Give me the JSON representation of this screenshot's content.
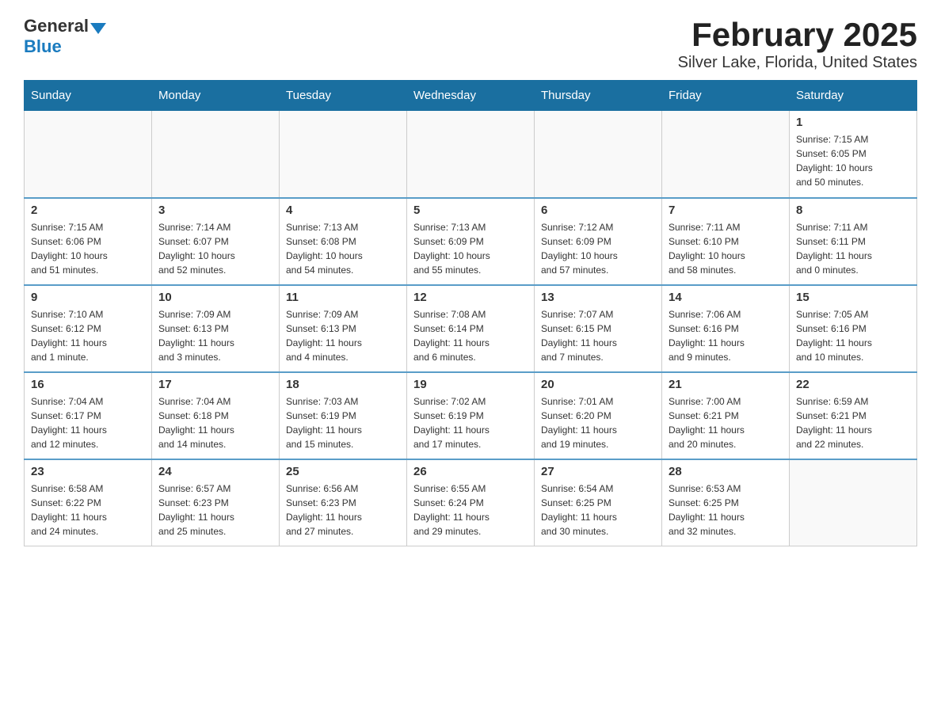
{
  "header": {
    "logo_general": "General",
    "logo_blue": "Blue",
    "title": "February 2025",
    "subtitle": "Silver Lake, Florida, United States"
  },
  "weekdays": [
    "Sunday",
    "Monday",
    "Tuesday",
    "Wednesday",
    "Thursday",
    "Friday",
    "Saturday"
  ],
  "weeks": [
    [
      {
        "day": "",
        "info": ""
      },
      {
        "day": "",
        "info": ""
      },
      {
        "day": "",
        "info": ""
      },
      {
        "day": "",
        "info": ""
      },
      {
        "day": "",
        "info": ""
      },
      {
        "day": "",
        "info": ""
      },
      {
        "day": "1",
        "info": "Sunrise: 7:15 AM\nSunset: 6:05 PM\nDaylight: 10 hours\nand 50 minutes."
      }
    ],
    [
      {
        "day": "2",
        "info": "Sunrise: 7:15 AM\nSunset: 6:06 PM\nDaylight: 10 hours\nand 51 minutes."
      },
      {
        "day": "3",
        "info": "Sunrise: 7:14 AM\nSunset: 6:07 PM\nDaylight: 10 hours\nand 52 minutes."
      },
      {
        "day": "4",
        "info": "Sunrise: 7:13 AM\nSunset: 6:08 PM\nDaylight: 10 hours\nand 54 minutes."
      },
      {
        "day": "5",
        "info": "Sunrise: 7:13 AM\nSunset: 6:09 PM\nDaylight: 10 hours\nand 55 minutes."
      },
      {
        "day": "6",
        "info": "Sunrise: 7:12 AM\nSunset: 6:09 PM\nDaylight: 10 hours\nand 57 minutes."
      },
      {
        "day": "7",
        "info": "Sunrise: 7:11 AM\nSunset: 6:10 PM\nDaylight: 10 hours\nand 58 minutes."
      },
      {
        "day": "8",
        "info": "Sunrise: 7:11 AM\nSunset: 6:11 PM\nDaylight: 11 hours\nand 0 minutes."
      }
    ],
    [
      {
        "day": "9",
        "info": "Sunrise: 7:10 AM\nSunset: 6:12 PM\nDaylight: 11 hours\nand 1 minute."
      },
      {
        "day": "10",
        "info": "Sunrise: 7:09 AM\nSunset: 6:13 PM\nDaylight: 11 hours\nand 3 minutes."
      },
      {
        "day": "11",
        "info": "Sunrise: 7:09 AM\nSunset: 6:13 PM\nDaylight: 11 hours\nand 4 minutes."
      },
      {
        "day": "12",
        "info": "Sunrise: 7:08 AM\nSunset: 6:14 PM\nDaylight: 11 hours\nand 6 minutes."
      },
      {
        "day": "13",
        "info": "Sunrise: 7:07 AM\nSunset: 6:15 PM\nDaylight: 11 hours\nand 7 minutes."
      },
      {
        "day": "14",
        "info": "Sunrise: 7:06 AM\nSunset: 6:16 PM\nDaylight: 11 hours\nand 9 minutes."
      },
      {
        "day": "15",
        "info": "Sunrise: 7:05 AM\nSunset: 6:16 PM\nDaylight: 11 hours\nand 10 minutes."
      }
    ],
    [
      {
        "day": "16",
        "info": "Sunrise: 7:04 AM\nSunset: 6:17 PM\nDaylight: 11 hours\nand 12 minutes."
      },
      {
        "day": "17",
        "info": "Sunrise: 7:04 AM\nSunset: 6:18 PM\nDaylight: 11 hours\nand 14 minutes."
      },
      {
        "day": "18",
        "info": "Sunrise: 7:03 AM\nSunset: 6:19 PM\nDaylight: 11 hours\nand 15 minutes."
      },
      {
        "day": "19",
        "info": "Sunrise: 7:02 AM\nSunset: 6:19 PM\nDaylight: 11 hours\nand 17 minutes."
      },
      {
        "day": "20",
        "info": "Sunrise: 7:01 AM\nSunset: 6:20 PM\nDaylight: 11 hours\nand 19 minutes."
      },
      {
        "day": "21",
        "info": "Sunrise: 7:00 AM\nSunset: 6:21 PM\nDaylight: 11 hours\nand 20 minutes."
      },
      {
        "day": "22",
        "info": "Sunrise: 6:59 AM\nSunset: 6:21 PM\nDaylight: 11 hours\nand 22 minutes."
      }
    ],
    [
      {
        "day": "23",
        "info": "Sunrise: 6:58 AM\nSunset: 6:22 PM\nDaylight: 11 hours\nand 24 minutes."
      },
      {
        "day": "24",
        "info": "Sunrise: 6:57 AM\nSunset: 6:23 PM\nDaylight: 11 hours\nand 25 minutes."
      },
      {
        "day": "25",
        "info": "Sunrise: 6:56 AM\nSunset: 6:23 PM\nDaylight: 11 hours\nand 27 minutes."
      },
      {
        "day": "26",
        "info": "Sunrise: 6:55 AM\nSunset: 6:24 PM\nDaylight: 11 hours\nand 29 minutes."
      },
      {
        "day": "27",
        "info": "Sunrise: 6:54 AM\nSunset: 6:25 PM\nDaylight: 11 hours\nand 30 minutes."
      },
      {
        "day": "28",
        "info": "Sunrise: 6:53 AM\nSunset: 6:25 PM\nDaylight: 11 hours\nand 32 minutes."
      },
      {
        "day": "",
        "info": ""
      }
    ]
  ]
}
